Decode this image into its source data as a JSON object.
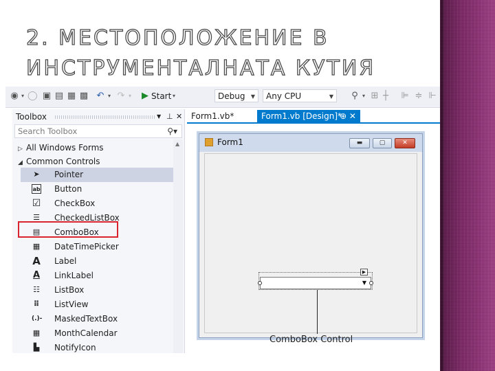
{
  "slide": {
    "title": "2. МЕСТОПОЛОЖЕНИЕ В ИНСТРУМЕНТАЛНАТА КУТИЯ"
  },
  "toolbar": {
    "start_label": "Start",
    "config": "Debug",
    "platform": "Any CPU"
  },
  "toolbox": {
    "title": "Toolbox",
    "search_placeholder": "Search Toolbox",
    "groups": [
      {
        "label": "All Windows Forms",
        "expanded": false
      },
      {
        "label": "Common Controls",
        "expanded": true
      }
    ],
    "items": [
      {
        "label": "Pointer",
        "icon": "pointer-icon",
        "glyph": "➤",
        "selected": true
      },
      {
        "label": "Button",
        "icon": "button-icon",
        "glyph": "ab",
        "selected": false
      },
      {
        "label": "CheckBox",
        "icon": "checkbox-icon",
        "glyph": "☑",
        "selected": false
      },
      {
        "label": "CheckedListBox",
        "icon": "checkedlistbox-icon",
        "glyph": "☰",
        "selected": false
      },
      {
        "label": "ComboBox",
        "icon": "combobox-icon",
        "glyph": "▤",
        "selected": false,
        "highlighted": true
      },
      {
        "label": "DateTimePicker",
        "icon": "datetimepicker-icon",
        "glyph": "▦",
        "selected": false
      },
      {
        "label": "Label",
        "icon": "label-icon",
        "glyph": "A",
        "selected": false
      },
      {
        "label": "LinkLabel",
        "icon": "linklabel-icon",
        "glyph": "A",
        "selected": false
      },
      {
        "label": "ListBox",
        "icon": "listbox-icon",
        "glyph": "☷",
        "selected": false
      },
      {
        "label": "ListView",
        "icon": "listview-icon",
        "glyph": "⠿",
        "selected": false
      },
      {
        "label": "MaskedTextBox",
        "icon": "maskedtextbox-icon",
        "glyph": "(.)-",
        "selected": false
      },
      {
        "label": "MonthCalendar",
        "icon": "monthcalendar-icon",
        "glyph": "▦",
        "selected": false
      },
      {
        "label": "NotifyIcon",
        "icon": "notifyicon-icon",
        "glyph": "▙",
        "selected": false
      }
    ]
  },
  "tabs": [
    {
      "label": "Form1.vb*",
      "active": false
    },
    {
      "label": "Form1.vb [Design]*",
      "active": true
    }
  ],
  "form": {
    "title": "Form1"
  },
  "annotation": "ComboBox Control",
  "colors": {
    "highlight_box": "#d9232f",
    "active_tab": "#007acc",
    "deco_band": "#7a2a64"
  }
}
